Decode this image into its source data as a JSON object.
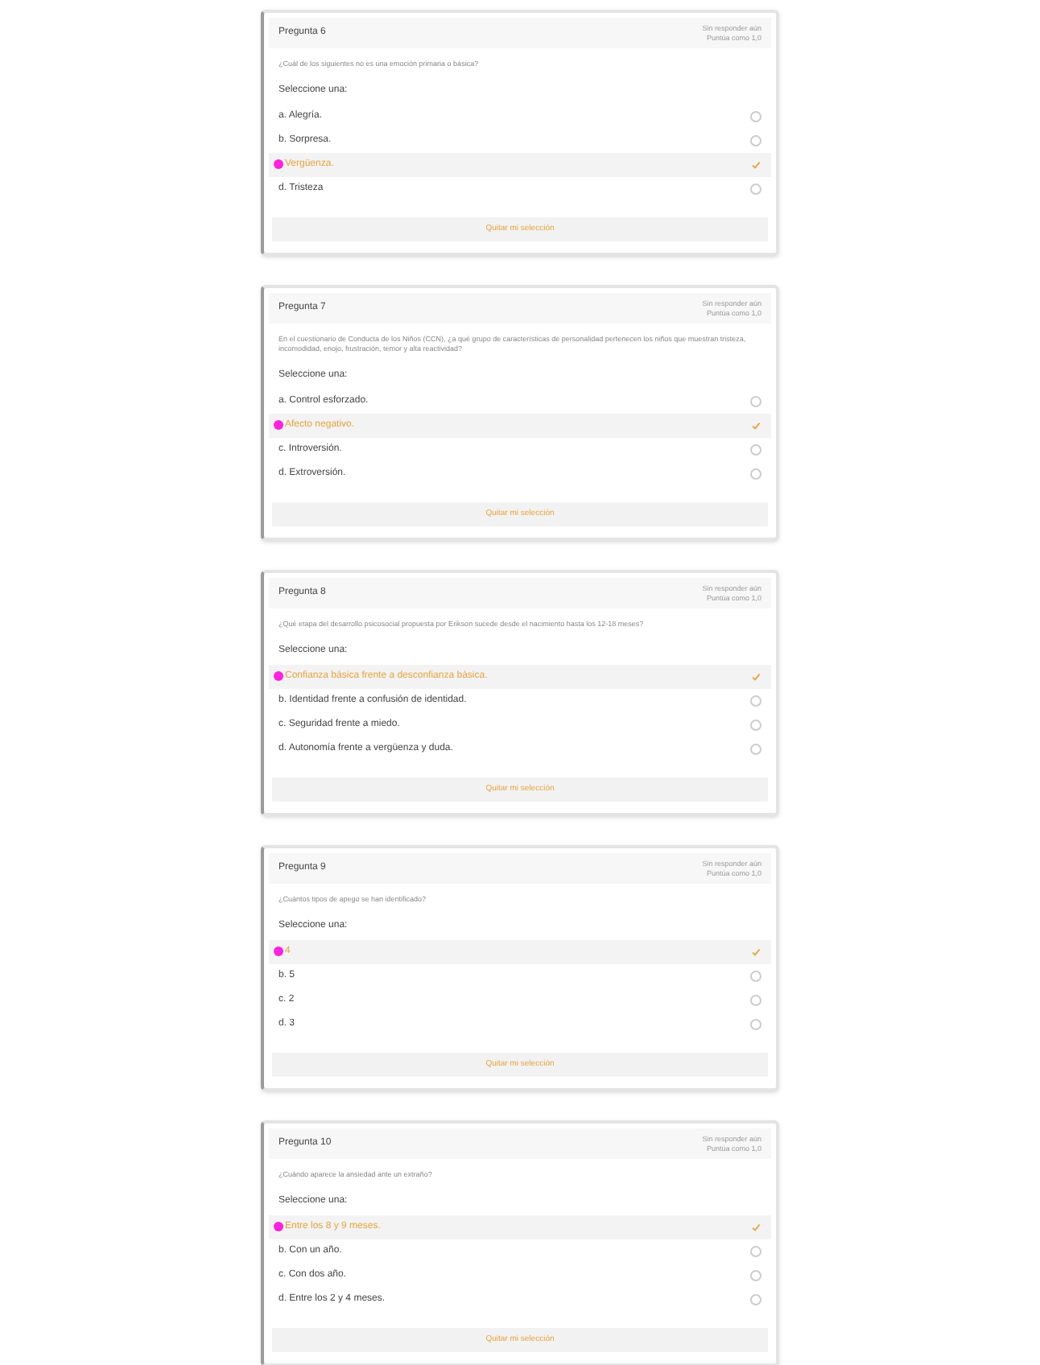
{
  "questions": [
    {
      "title": "Pregunta 6",
      "status": "Sin responder aún",
      "score": "Puntúa como 1,0",
      "text": "¿Cuál de los siguientes no es una emoción primaria o básica?",
      "prompt": "Seleccione una:",
      "options": [
        {
          "label": "a. Alegría.",
          "selected": false
        },
        {
          "label": "b. Sorpresa.",
          "selected": false
        },
        {
          "label": "Vergüenza.",
          "selected": true
        },
        {
          "label": "d. Tristeza",
          "selected": false
        }
      ],
      "clear": "Quitar mi selección"
    },
    {
      "title": "Pregunta 7",
      "status": "Sin responder aún",
      "score": "Puntúa como 1,0",
      "text": "En el cuestionario de Conducta de los Niños (CCN), ¿a qué grupo de características de personalidad pertenecen los niños que muestran tristeza, incomodidad, enojo, frustración, temor y alta reactividad?",
      "prompt": "Seleccione una:",
      "options": [
        {
          "label": "a. Control esforzado.",
          "selected": false
        },
        {
          "label": "Afecto negativo.",
          "selected": true
        },
        {
          "label": "c. Introversión.",
          "selected": false
        },
        {
          "label": "d. Extroversión.",
          "selected": false
        }
      ],
      "clear": "Quitar mi selección"
    },
    {
      "title": "Pregunta 8",
      "status": "Sin responder aún",
      "score": "Puntúa como 1,0",
      "text": "¿Qué etapa del desarrollo psicosocial propuesta por Erikson sucede desde el nacimiento hasta los 12-18 meses?",
      "prompt": "Seleccione una:",
      "options": [
        {
          "label": "Confianza básica frente a desconfianza básica.",
          "selected": true
        },
        {
          "label": "b. Identidad frente a confusión de identidad.",
          "selected": false
        },
        {
          "label": "c. Seguridad frente a miedo.",
          "selected": false
        },
        {
          "label": "d. Autonomía frente a vergüenza y duda.",
          "selected": false
        }
      ],
      "clear": "Quitar mi selección"
    },
    {
      "title": "Pregunta 9",
      "status": "Sin responder aún",
      "score": "Puntúa como 1,0",
      "text": "¿Cuántos tipos de apego se han identificado?",
      "prompt": "Seleccione una:",
      "options": [
        {
          "label": "4",
          "selected": true
        },
        {
          "label": "b. 5",
          "selected": false
        },
        {
          "label": "c. 2",
          "selected": false
        },
        {
          "label": "d. 3",
          "selected": false
        }
      ],
      "clear": "Quitar mi selección"
    },
    {
      "title": "Pregunta 10",
      "status": "Sin responder aún",
      "score": "Puntúa como 1,0",
      "text": "¿Cuándo aparece la ansiedad ante un extraño?",
      "prompt": "Seleccione una:",
      "options": [
        {
          "label": "Entre los 8 y 9 meses.",
          "selected": true
        },
        {
          "label": "b. Con un año.",
          "selected": false
        },
        {
          "label": "c. Con dos año.",
          "selected": false
        },
        {
          "label": "d. Entre los 2 y 4 meses.",
          "selected": false
        }
      ],
      "clear": "Quitar mi selección"
    }
  ]
}
